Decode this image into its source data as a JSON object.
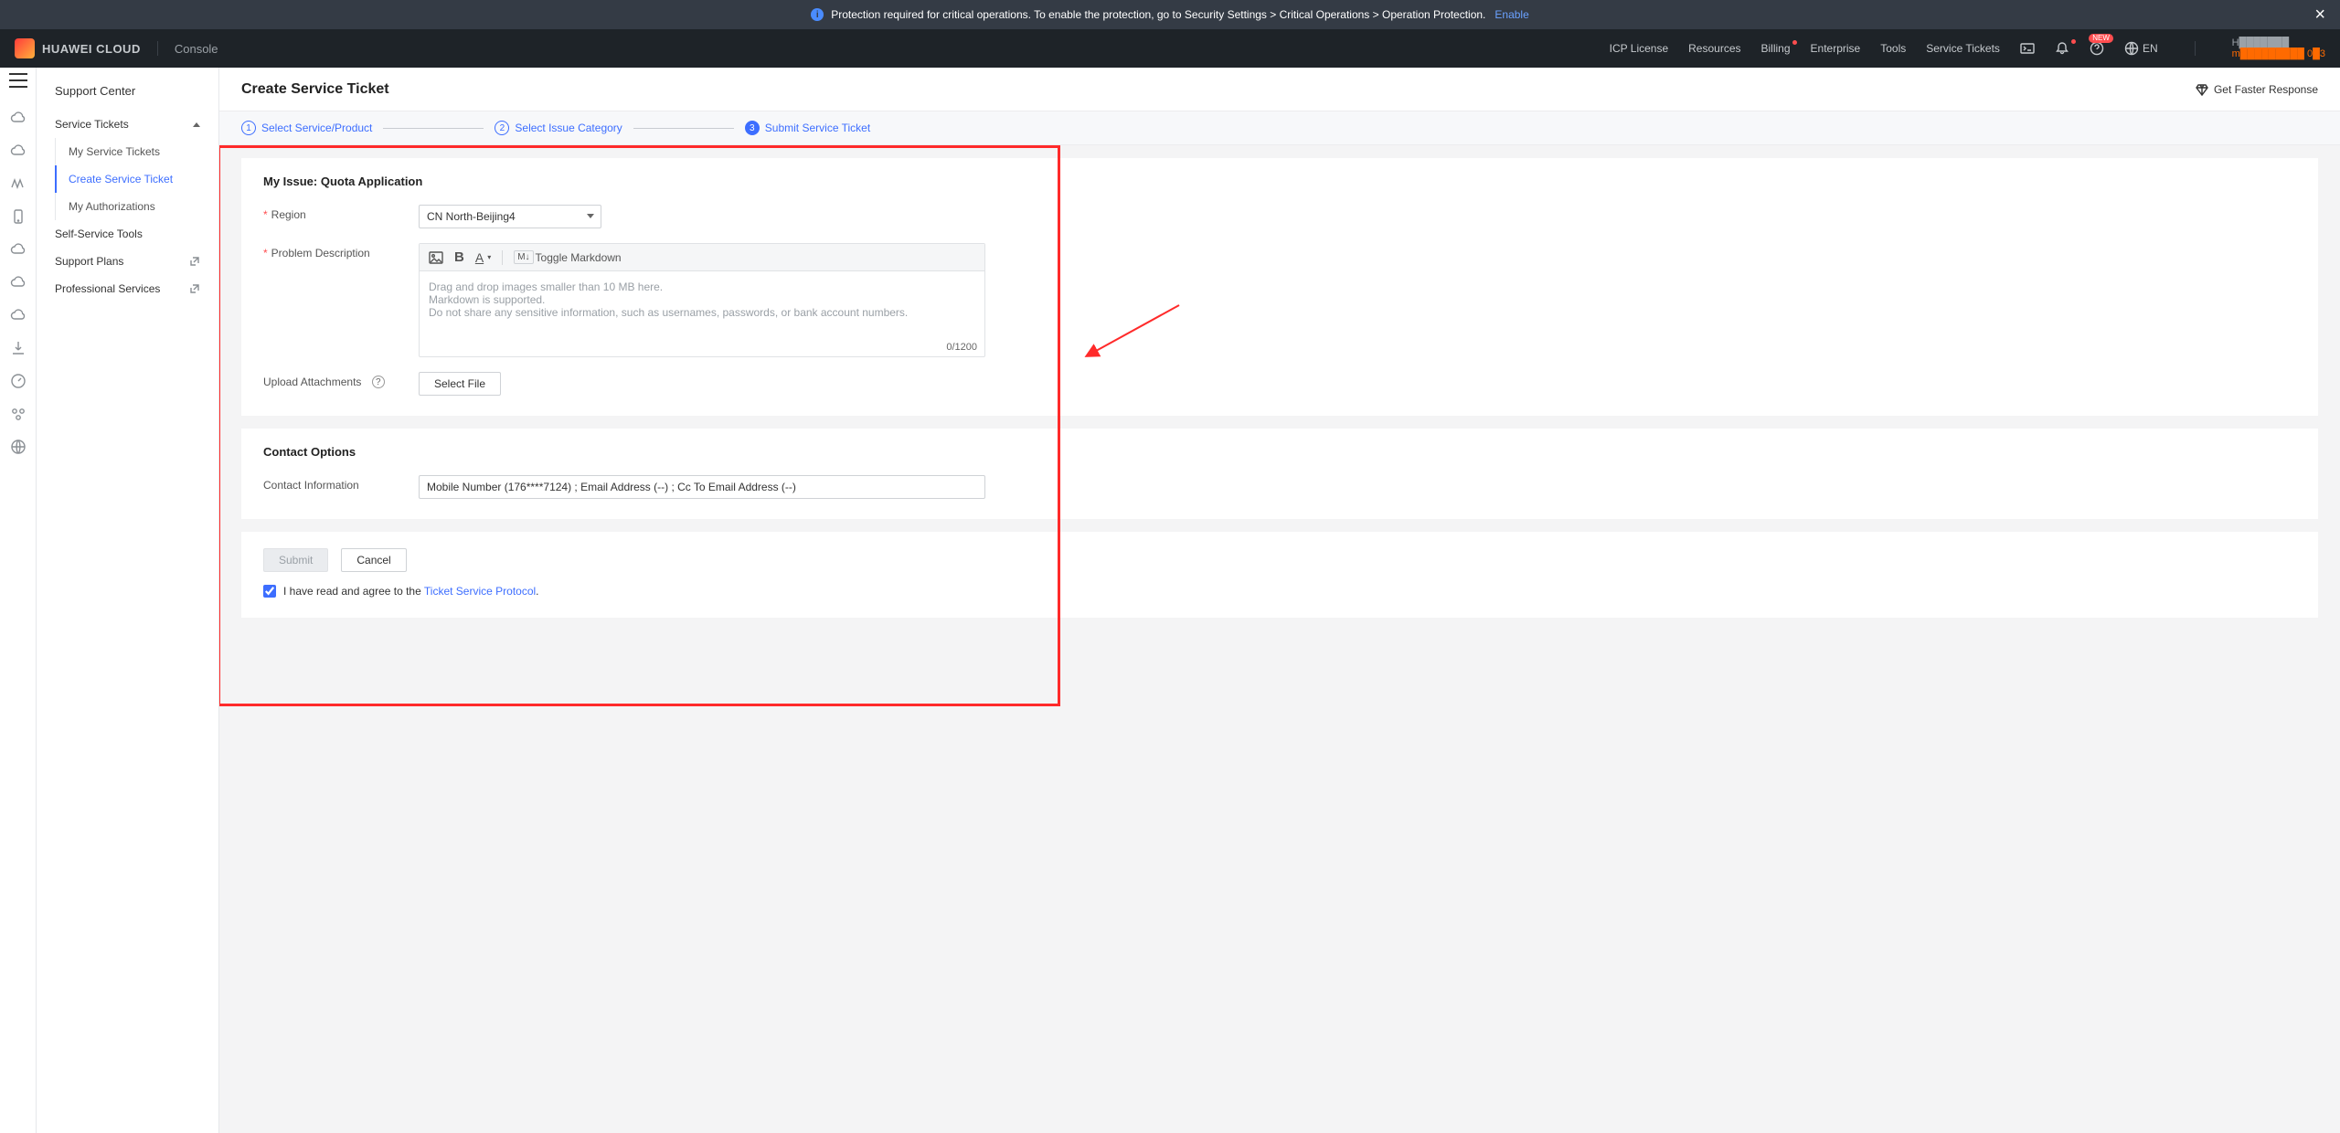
{
  "announce": {
    "text": "Protection required for critical operations. To enable the protection, go to Security Settings > Critical Operations > Operation Protection.",
    "link": "Enable"
  },
  "brand": "HUAWEI CLOUD",
  "console": "Console",
  "topnav": {
    "icp": "ICP License",
    "resources": "Resources",
    "billing": "Billing",
    "enterprise": "Enterprise",
    "tools": "Tools",
    "tickets": "Service Tickets",
    "lang": "EN"
  },
  "account": {
    "line1": "H███████",
    "line2": "m█████████ 0█3"
  },
  "nav": {
    "title": "Support Center",
    "group_tickets": "Service Tickets",
    "child_my": "My Service Tickets",
    "child_create": "Create Service Ticket",
    "child_auth": "My Authorizations",
    "self_service": "Self-Service Tools",
    "support_plans": "Support Plans",
    "pro_services": "Professional Services"
  },
  "page": {
    "title": "Create Service Ticket",
    "faster": "Get Faster Response"
  },
  "steps": {
    "s1": "Select Service/Product",
    "s2": "Select Issue Category",
    "s3": "Submit Service Ticket"
  },
  "issue": {
    "section": "My Issue: Quota Application",
    "region_label": "Region",
    "region_value": "CN North-Beijing4",
    "desc_label": "Problem Description",
    "desc_placeholder": "Drag and drop images smaller than 10 MB here.\nMarkdown is supported.\nDo not share any sensitive information, such as usernames, passwords, or bank account numbers.",
    "char_count": "0/1200",
    "toggle_md": "Toggle Markdown",
    "upload_label": "Upload Attachments",
    "select_file": "Select File"
  },
  "contact": {
    "section": "Contact Options",
    "label": "Contact Information",
    "value": "Mobile Number (176****7124) ; Email Address (--) ; Cc To Email Address (--)"
  },
  "actions": {
    "submit": "Submit",
    "cancel": "Cancel",
    "agree_pre": "I have read and agree to the ",
    "agree_link": "Ticket Service Protocol"
  }
}
